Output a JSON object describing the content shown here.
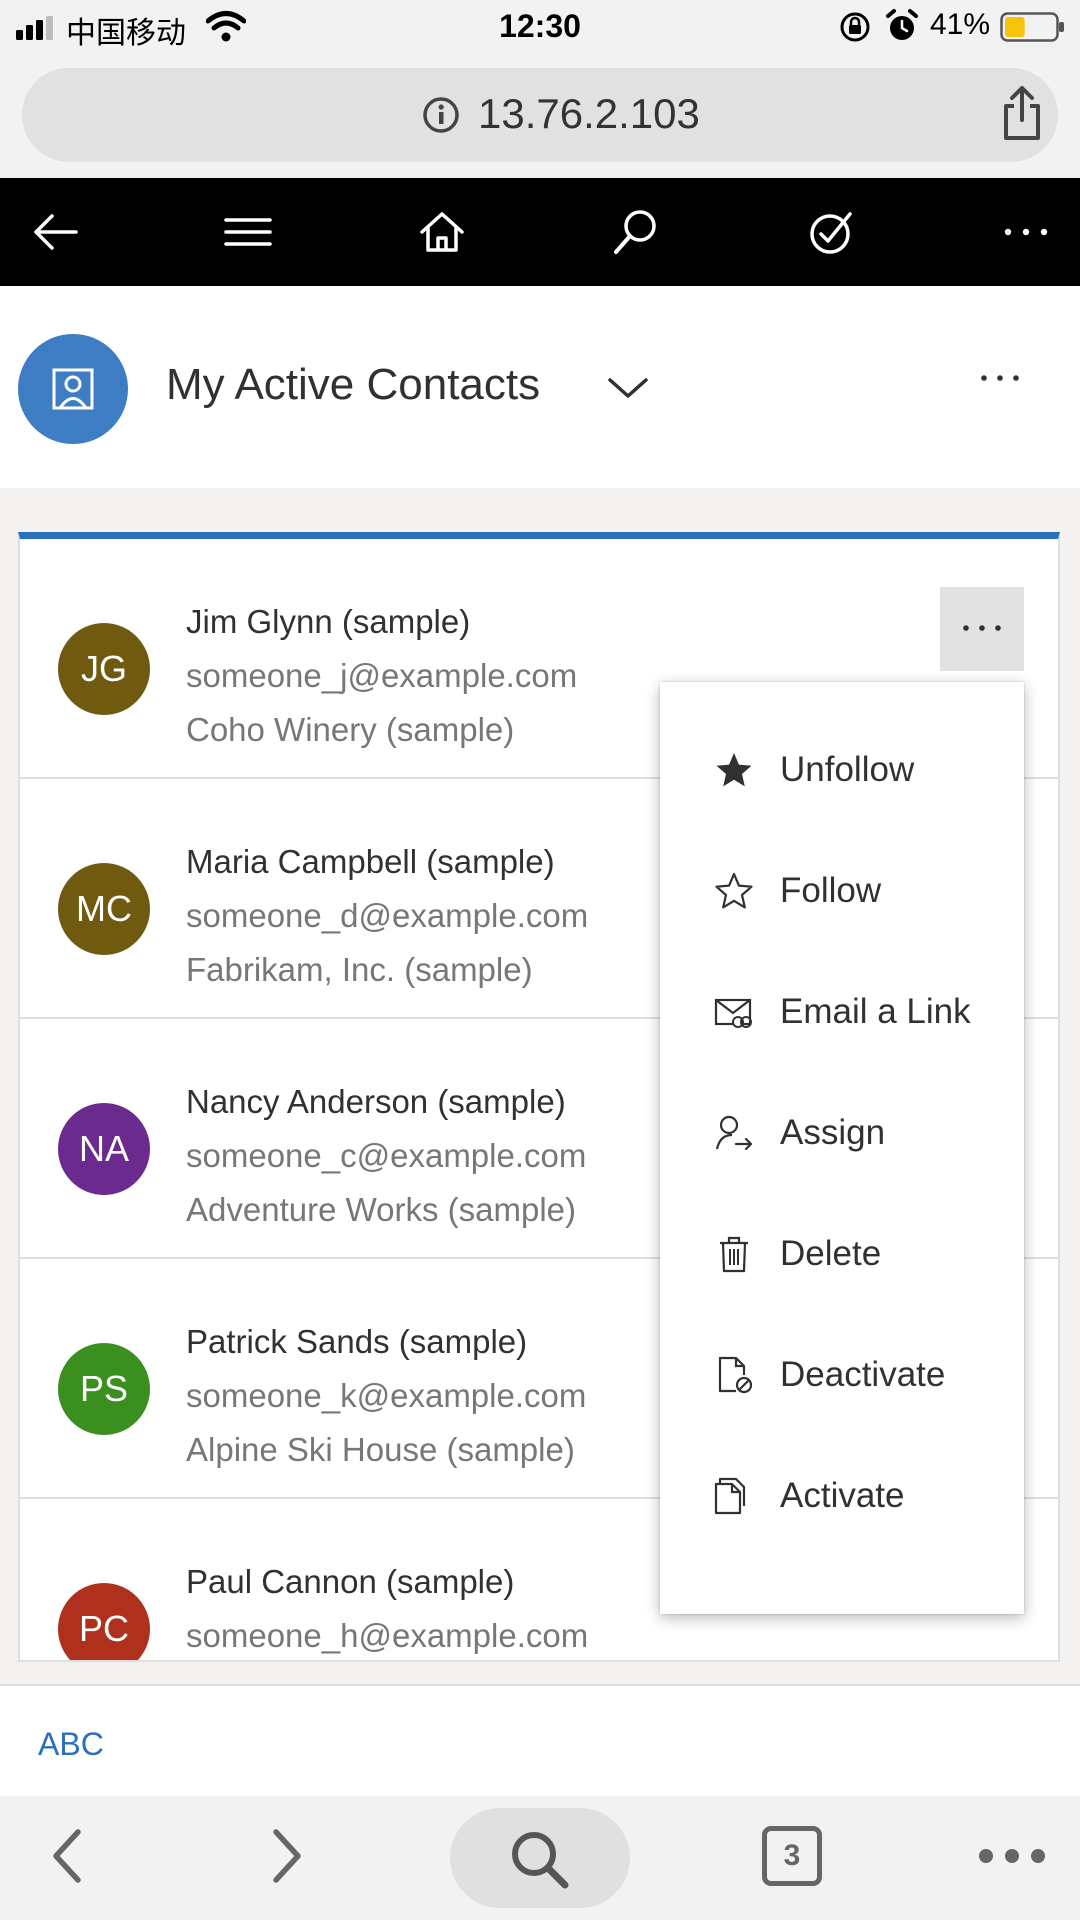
{
  "status_bar": {
    "carrier": "中国移动",
    "time": "12:30",
    "battery_percent": "41%",
    "battery_level": 0.41,
    "battery_color": "#f7c20c"
  },
  "address_bar": {
    "url": "13.76.2.103",
    "left_icon": "info-icon",
    "right_icon": "share-icon"
  },
  "app_toolbar": {
    "icons": [
      "back-arrow-icon",
      "hamburger-menu-icon",
      "home-icon",
      "search-icon",
      "task-check-icon",
      "more-icon"
    ]
  },
  "view": {
    "title": "My Active Contacts",
    "entity_icon": "contact-card-icon",
    "entity_color": "#3e7cc4",
    "accent_color": "#2c6fbd"
  },
  "contacts": [
    {
      "initials": "JG",
      "name": "Jim Glynn (sample)",
      "email": "someone_j@example.com",
      "company": "Coho Winery (sample)",
      "color": "#6f5a10"
    },
    {
      "initials": "MC",
      "name": "Maria Campbell (sample)",
      "email": "someone_d@example.com",
      "company": "Fabrikam, Inc. (sample)",
      "color": "#6f5a10"
    },
    {
      "initials": "NA",
      "name": "Nancy Anderson (sample)",
      "email": "someone_c@example.com",
      "company": "Adventure Works (sample)",
      "color": "#6b2a8e"
    },
    {
      "initials": "PS",
      "name": "Patrick Sands (sample)",
      "email": "someone_k@example.com",
      "company": "Alpine Ski House (sample)",
      "color": "#3a8f1e"
    },
    {
      "initials": "PC",
      "name": "Paul Cannon (sample)",
      "email": "someone_h@example.com",
      "company": "",
      "color": "#b0301e"
    }
  ],
  "context_menu": {
    "items": [
      {
        "label": "Unfollow",
        "icon": "star-filled-icon"
      },
      {
        "label": "Follow",
        "icon": "star-outline-icon"
      },
      {
        "label": "Email a Link",
        "icon": "email-link-icon"
      },
      {
        "label": "Assign",
        "icon": "assign-person-icon"
      },
      {
        "label": "Delete",
        "icon": "trash-icon"
      },
      {
        "label": "Deactivate",
        "icon": "deactivate-document-icon"
      },
      {
        "label": "Activate",
        "icon": "activate-document-icon"
      }
    ]
  },
  "footer": {
    "jump_bar_label": "ABC"
  },
  "browser_bar": {
    "tab_count": "3",
    "icons": [
      "back-chevron-icon",
      "forward-chevron-icon",
      "search-icon",
      "tabs-icon",
      "more-icon"
    ]
  }
}
